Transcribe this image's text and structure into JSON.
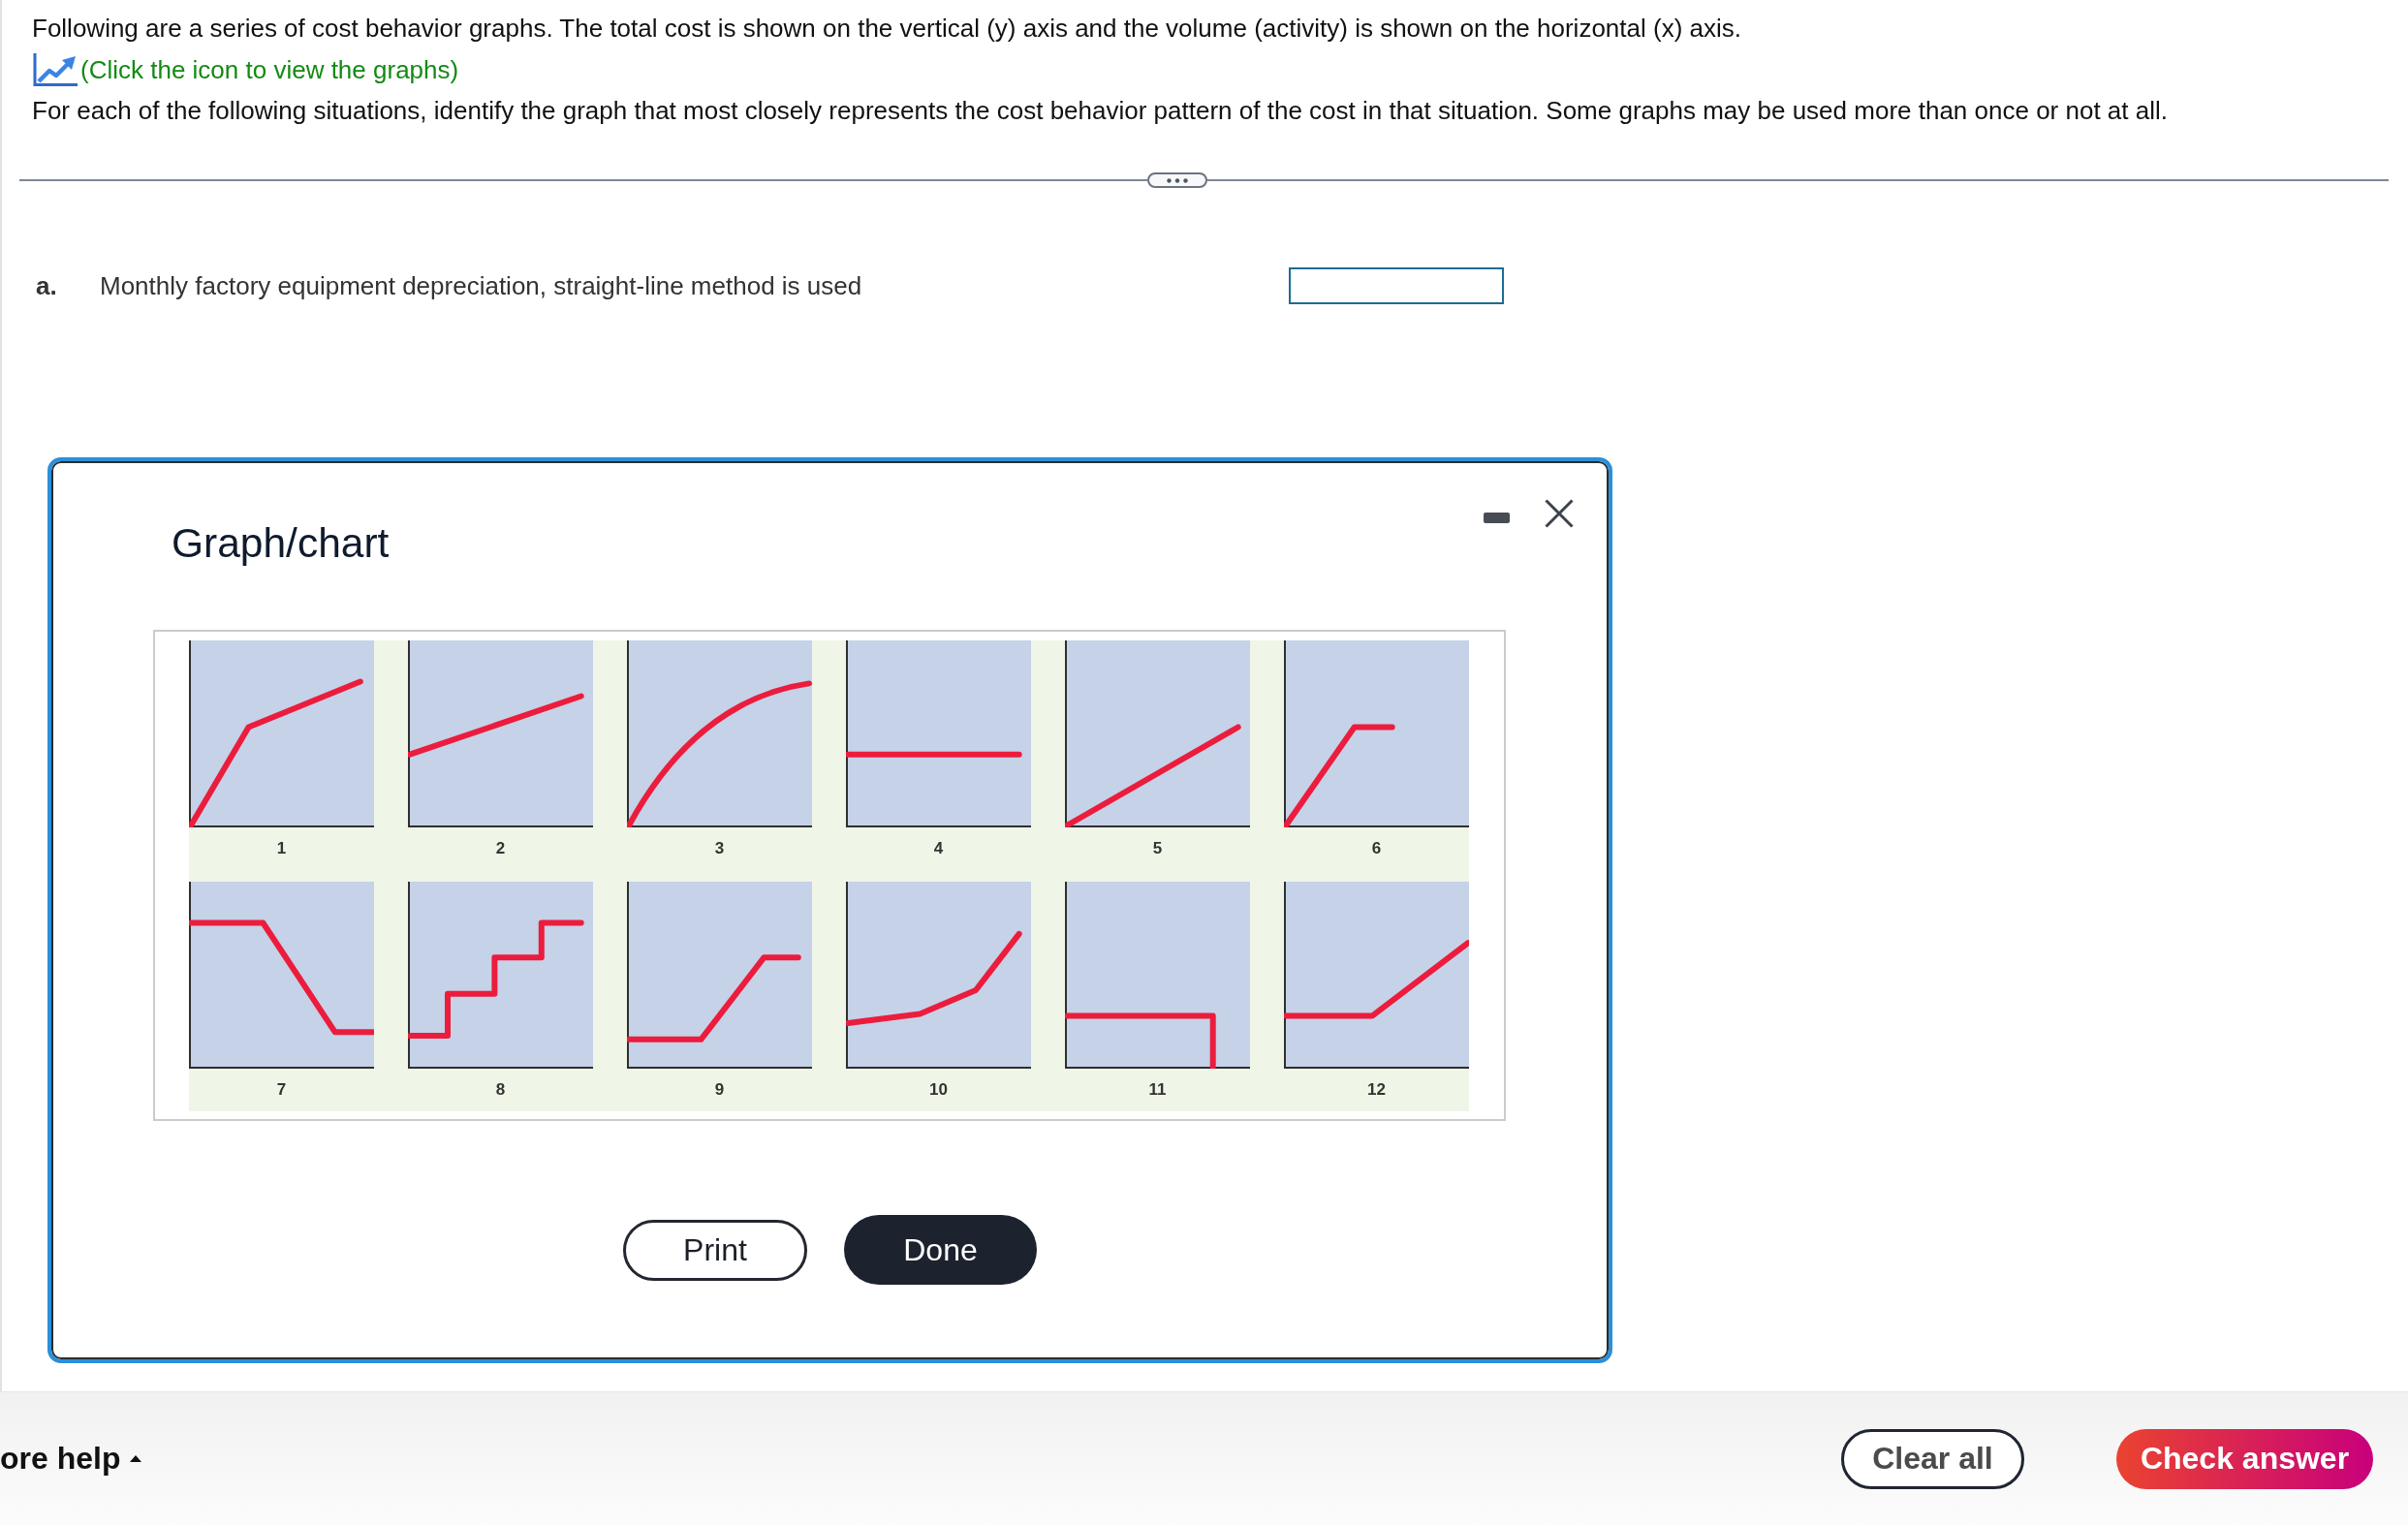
{
  "instructions": {
    "intro": "Following are a series of cost behavior graphs. The total cost is shown on the vertical (y) axis and the volume (activity) is shown on the horizontal (x) axis.",
    "graphs_hint": "(Click the icon to view the graphs)",
    "task": "For each of the following situations, identify the graph that most closely represents the cost behavior pattern of the cost in that situation. Some graphs may be used more than once or not at all."
  },
  "questions": [
    {
      "letter": "a.",
      "text": "Monthly factory equipment depreciation, straight-line method is used"
    }
  ],
  "dialog": {
    "title": "Graph/chart",
    "graphs": [
      {
        "label": "1"
      },
      {
        "label": "2"
      },
      {
        "label": "3"
      },
      {
        "label": "4"
      },
      {
        "label": "5"
      },
      {
        "label": "6"
      },
      {
        "label": "7"
      },
      {
        "label": "8"
      },
      {
        "label": "9"
      },
      {
        "label": "10"
      },
      {
        "label": "11"
      },
      {
        "label": "12"
      }
    ],
    "buttons": [
      {
        "label": "Print",
        "kind": "secondary"
      },
      {
        "label": "Done",
        "kind": "primary"
      }
    ]
  },
  "footer": {
    "help": "ore help",
    "buttons": [
      {
        "label": "Clear all",
        "kind": "secondary"
      },
      {
        "label": "Check answer",
        "kind": "primary"
      }
    ]
  }
}
